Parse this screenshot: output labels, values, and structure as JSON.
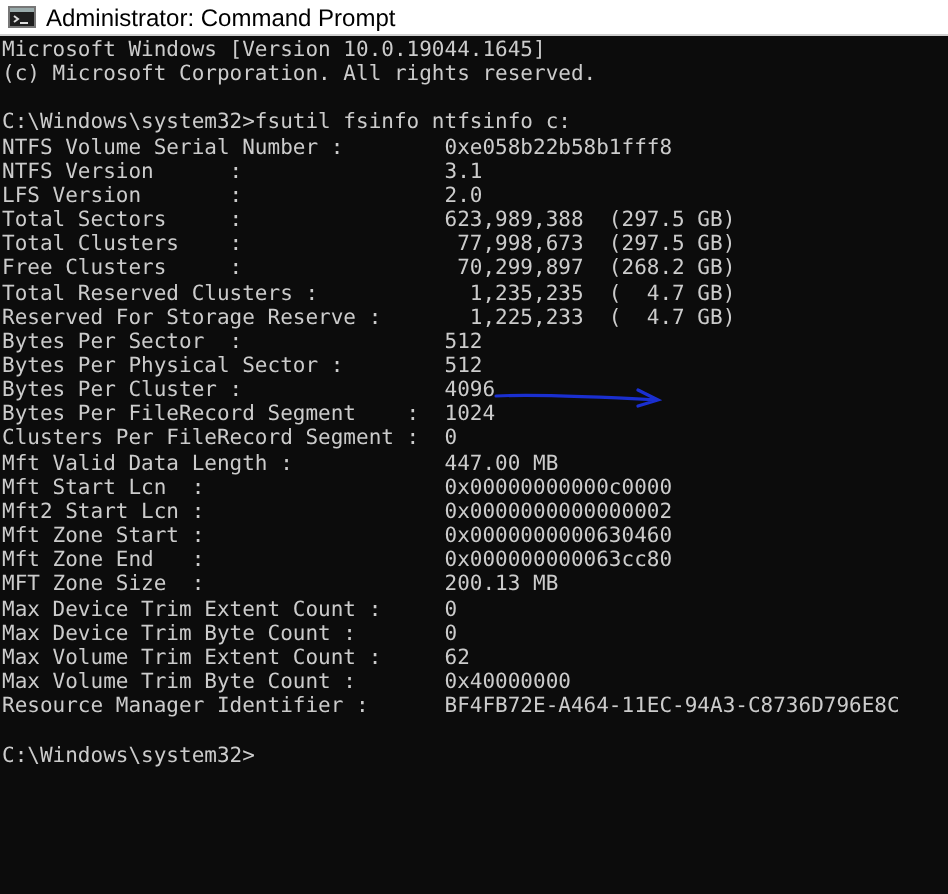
{
  "window": {
    "title": "Administrator: Command Prompt"
  },
  "console": {
    "blocks": [
      {
        "lines": [
          "Microsoft Windows [Version 10.0.19044.1645]",
          "(c) Microsoft Corporation. All rights reserved."
        ]
      },
      {
        "lines": [
          "C:\\Windows\\system32>fsutil fsinfo ntfsinfo c:",
          "NTFS Volume Serial Number :        0xe058b22b58b1fff8",
          "NTFS Version      :                3.1",
          "LFS Version       :                2.0",
          "Total Sectors     :                623,989,388  (297.5 GB)",
          "Total Clusters    :                 77,998,673  (297.5 GB)",
          "Free Clusters     :                 70,299,897  (268.2 GB)",
          "Total Reserved Clusters :            1,235,235  (  4.7 GB)",
          "Reserved For Storage Reserve :       1,225,233  (  4.7 GB)",
          "Bytes Per Sector  :                512",
          "Bytes Per Physical Sector :        512",
          "Bytes Per Cluster :                4096",
          "Bytes Per FileRecord Segment    :  1024",
          "Clusters Per FileRecord Segment :  0",
          "Mft Valid Data Length :            447.00 MB",
          "Mft Start Lcn  :                   0x00000000000c0000",
          "Mft2 Start Lcn :                   0x0000000000000002",
          "Mft Zone Start :                   0x0000000000630460",
          "Mft Zone End   :                   0x000000000063cc80",
          "MFT Zone Size  :                   200.13 MB",
          "Max Device Trim Extent Count :     0",
          "Max Device Trim Byte Count :       0",
          "Max Volume Trim Extent Count :     62",
          "Max Volume Trim Byte Count :       0x40000000",
          "Resource Manager Identifier :      BF4FB72E-A464-11EC-94A3-C8736D796E8C"
        ]
      },
      {
        "lines": [
          "C:\\Windows\\system32>"
        ]
      }
    ]
  }
}
